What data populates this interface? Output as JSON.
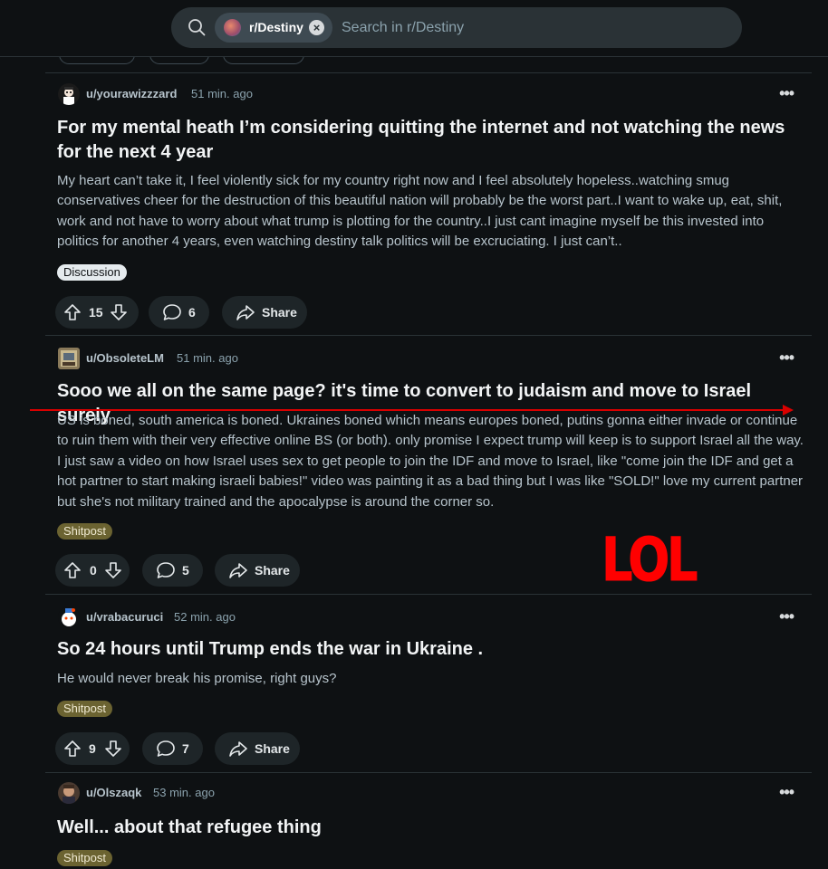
{
  "search": {
    "subreddit_chip": "r/Destiny",
    "placeholder": "Search in r/Destiny"
  },
  "annotation": {
    "text": "LOL",
    "color": "#ff0000"
  },
  "posts": [
    {
      "user": "u/yourawizzzard",
      "age": "51 min. ago",
      "title": "For my mental heath I’m considering quitting the internet and not watching the news for the next 4 year",
      "body": "My heart can’t take it, I feel violently sick for my country right now and I feel absolutely hopeless..watching smug conservatives cheer for the destruction of this beautiful nation will probably be the worst part..I want to wake up, eat, shit, work and not have to worry about what trump is plotting for the country..I just cant imagine myself be this invested into politics for another 4 years, even watching destiny talk politics will be excruciating. I just can’t..",
      "flair": "Discussion",
      "votes": "15",
      "comments": "6",
      "share": "Share"
    },
    {
      "user": "u/ObsoleteLM",
      "age": "51 min. ago",
      "title": "Sooo we all on the same page? it's time to convert to judaism and move to Israel surely",
      "body": "US is boned, south america is boned. Ukraines boned which means europes boned, putins gonna either invade or continue to ruin them with their very effective online BS (or both). only promise I expect trump will keep is to support Israel all the way. I just saw a video on how Israel uses sex to get people to join the IDF and move to Israel, like \"come join the IDF and get a hot partner to start making israeli babies!\" video was painting it as a bad thing but I was like \"SOLD!\" love my current partner but she's not military trained and the apocalypse is around the corner so.",
      "flair": "Shitpost",
      "votes": "0",
      "comments": "5",
      "share": "Share"
    },
    {
      "user": "u/vrabacuruci",
      "age": "52 min. ago",
      "title": "So 24 hours until Trump ends the war in Ukraine .",
      "body": "He would never break his promise, right guys?",
      "flair": "Shitpost",
      "votes": "9",
      "comments": "7",
      "share": "Share"
    },
    {
      "user": "u/Olszaqk",
      "age": "53 min. ago",
      "title": "Well... about that refugee thing",
      "flair": "Shitpost"
    }
  ]
}
